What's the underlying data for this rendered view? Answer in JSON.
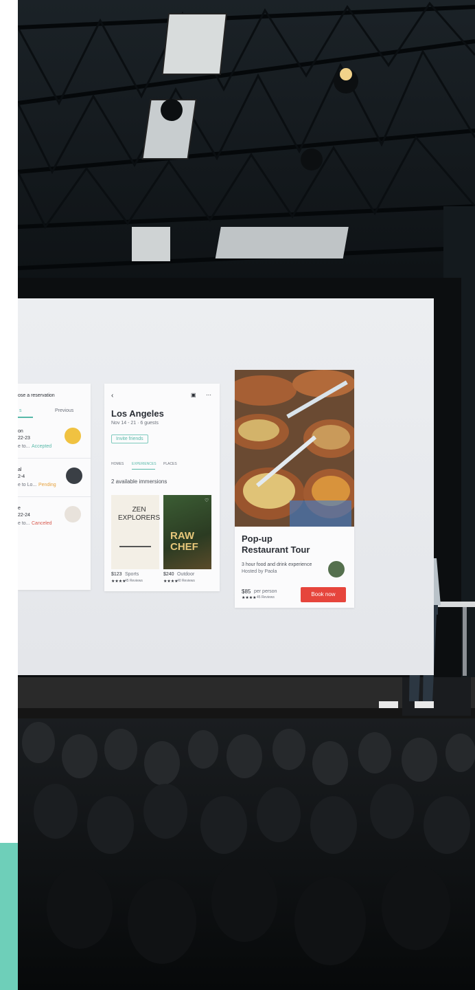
{
  "card_reservations": {
    "title": "ose a reservation",
    "tab_active": "s",
    "tab_previous": "Previous",
    "rows": [
      {
        "name": "on",
        "dates": "22-23",
        "status_prefix": "e to...",
        "status": "Accepted"
      },
      {
        "name": "al",
        "dates": "2-4",
        "status_prefix": "e to Lo...",
        "status": "Pending"
      },
      {
        "name": "e",
        "dates": "22-24",
        "status_prefix": "e to...",
        "status": "Canceled"
      }
    ]
  },
  "card_city": {
    "back_icon": "chevron-left-icon",
    "title": "Los Angeles",
    "subtitle": "Nov 14 - 21 · 6 guests",
    "invite_label": "Invite friends",
    "tabs": [
      "HOMES",
      "EXPERIENCES",
      "PLACES"
    ],
    "immersions_label": "2 available immersions",
    "tiles": [
      {
        "cover_title": "ZEN\nEXPLORERS",
        "price": "$123",
        "category": "Sports",
        "reviews": "45 Reviews"
      },
      {
        "cover_title": "RAW\nCHEF",
        "price": "$240",
        "category": "Outdoor",
        "reviews": "40 Reviews"
      }
    ]
  },
  "card_experience": {
    "title_line1": "Pop-up",
    "title_line2": "Restaurant Tour",
    "description": "3 hour food and drink experience",
    "host": "Hosted by Paola",
    "price": "$85",
    "price_unit": "per person",
    "reviews": "45 Reviews",
    "book_label": "Book now"
  },
  "colors": {
    "accent_teal": "#6ecfb9",
    "book_red": "#e6453c"
  }
}
